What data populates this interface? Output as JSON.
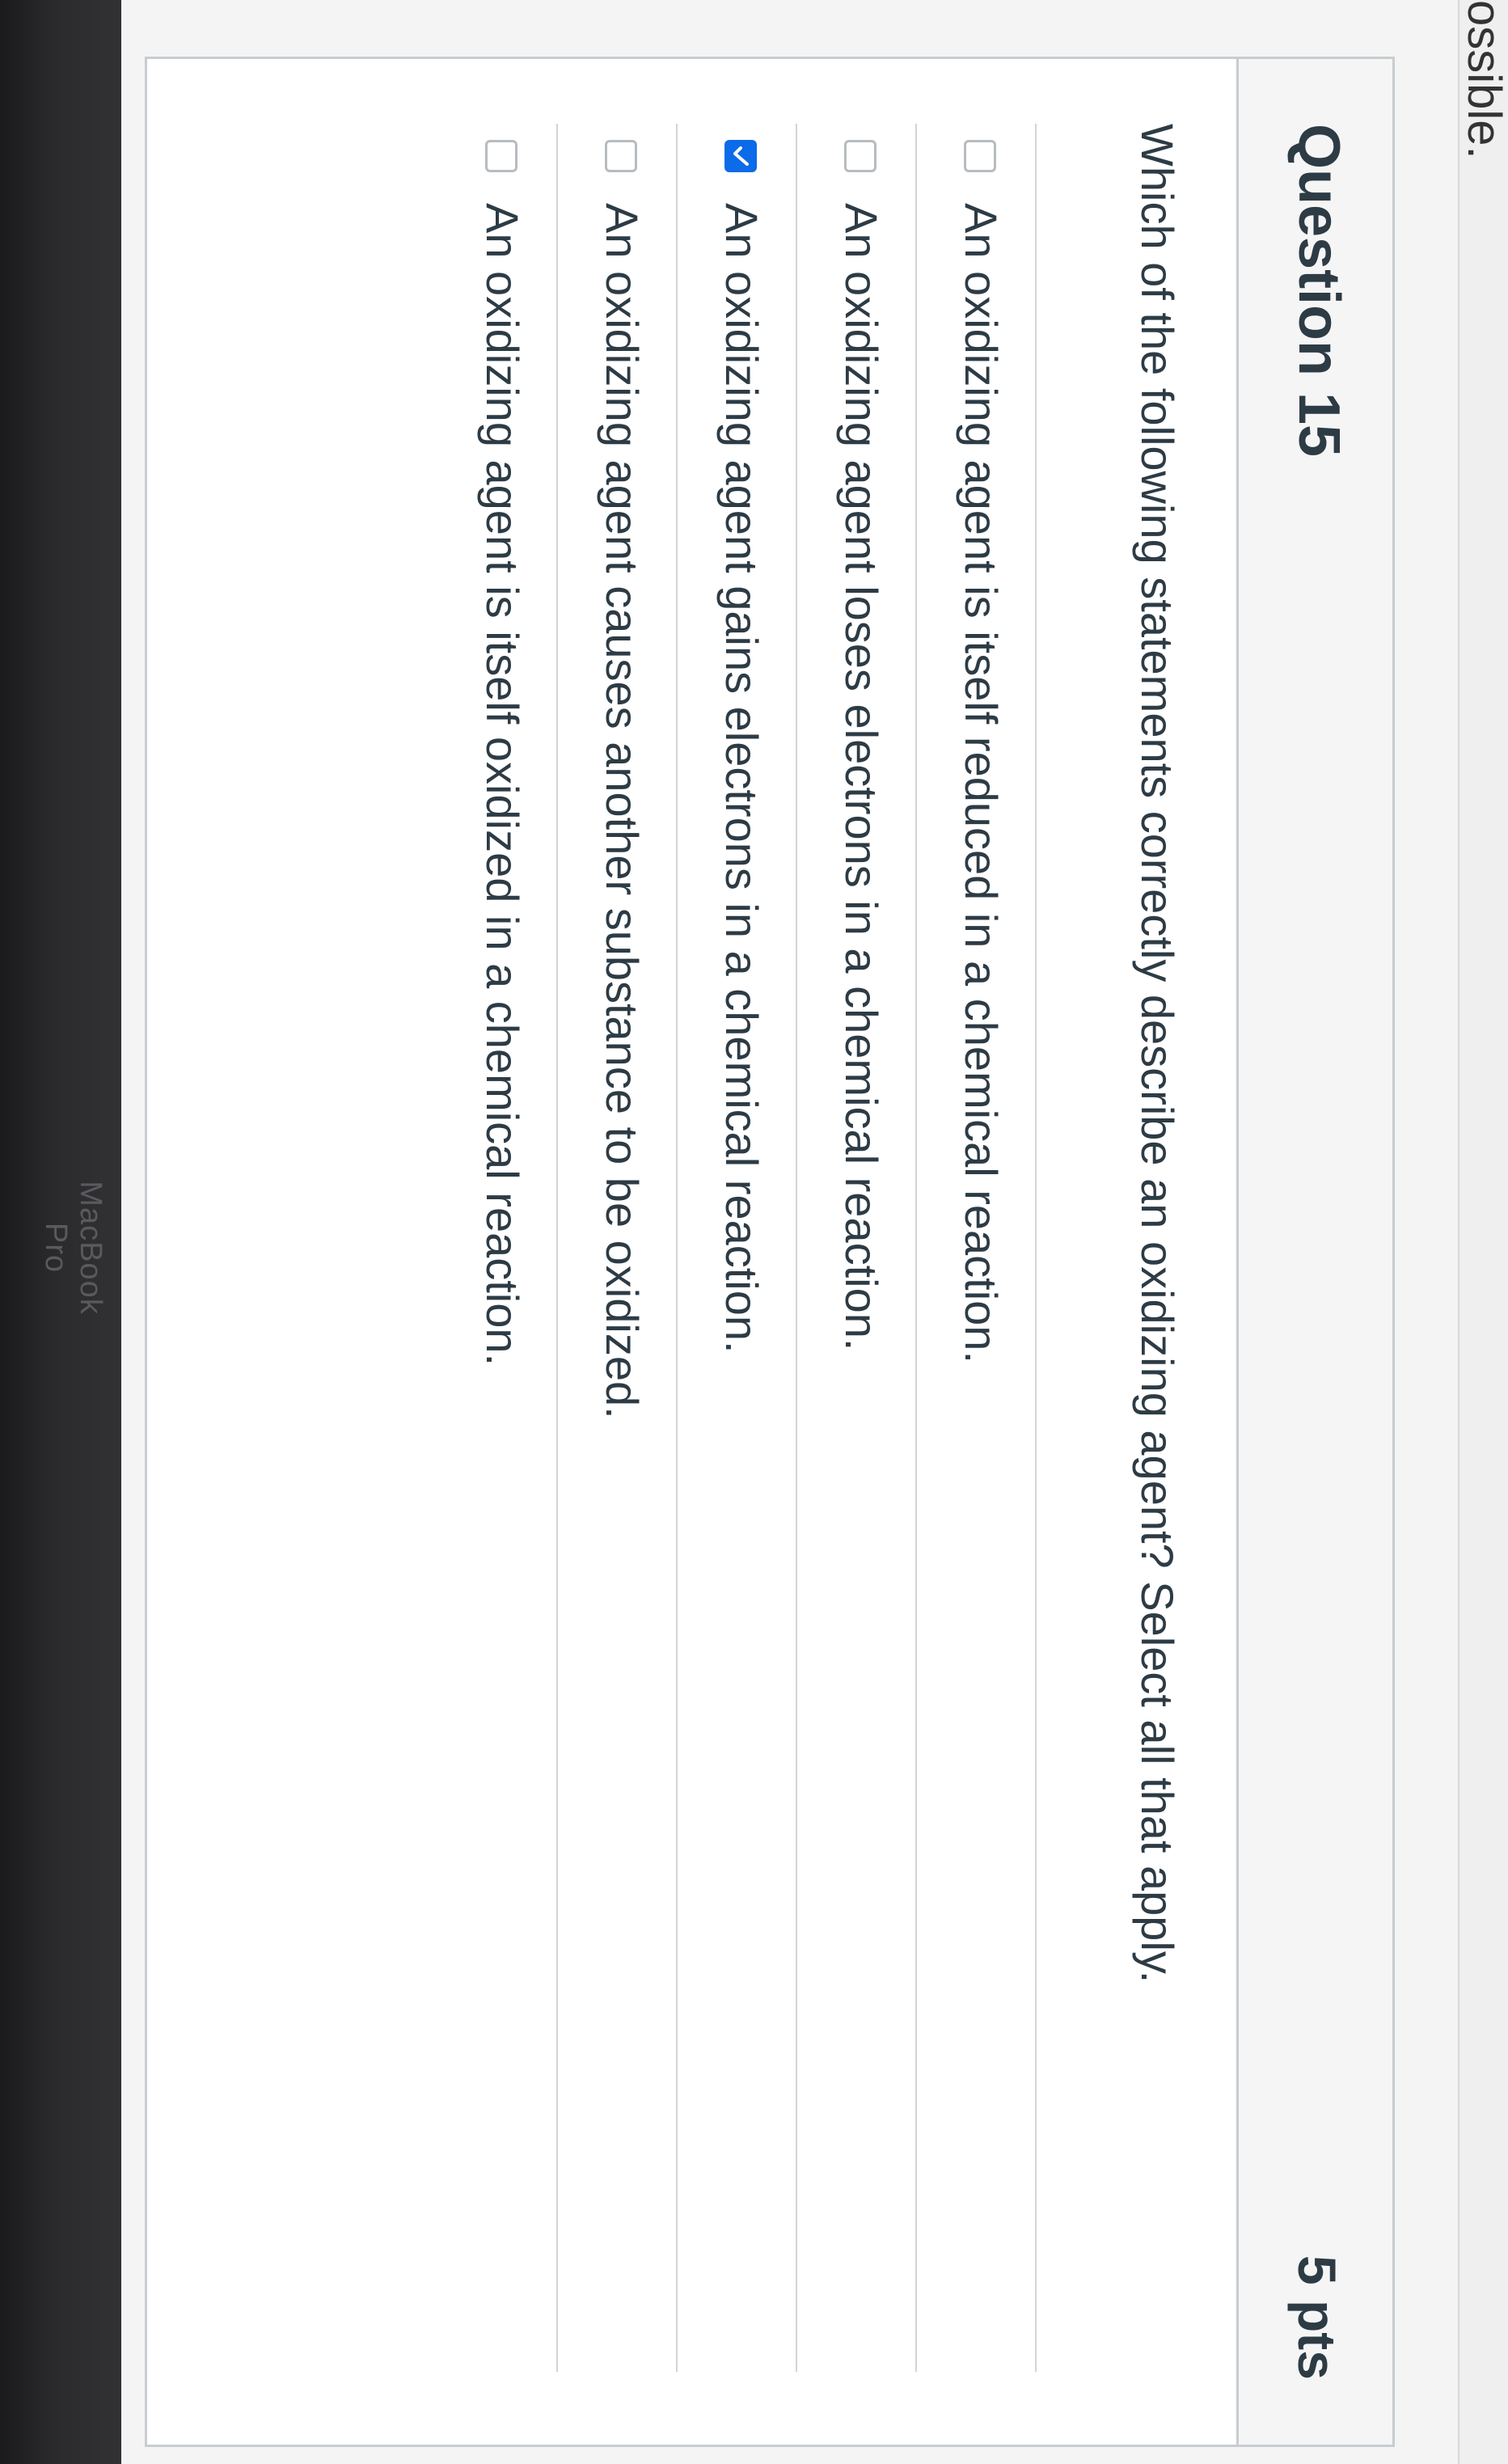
{
  "device": {
    "label": "MacBook Pro"
  },
  "page": {
    "snippet_text": "ossible."
  },
  "question": {
    "title": "Question 15",
    "points": "5 pts",
    "prompt": "Which of the following statements correctly describe an oxidizing agent? Select all that apply.",
    "answers": [
      {
        "label": "An oxidizing agent is itself reduced in a chemical reaction.",
        "checked": false
      },
      {
        "label": "An oxidizing agent loses electrons in a chemical reaction.",
        "checked": false
      },
      {
        "label": "An oxidizing agent gains electrons in a chemical reaction.",
        "checked": true
      },
      {
        "label": "An oxidizing agent causes another substance to be oxidized.",
        "checked": false
      },
      {
        "label": "An oxidizing agent is itself oxidized in a chemical reaction.",
        "checked": false
      }
    ]
  },
  "colors": {
    "checkbox_checked": "#0b6be8",
    "text": "#2d3b45",
    "border": "#c7cdd1"
  }
}
